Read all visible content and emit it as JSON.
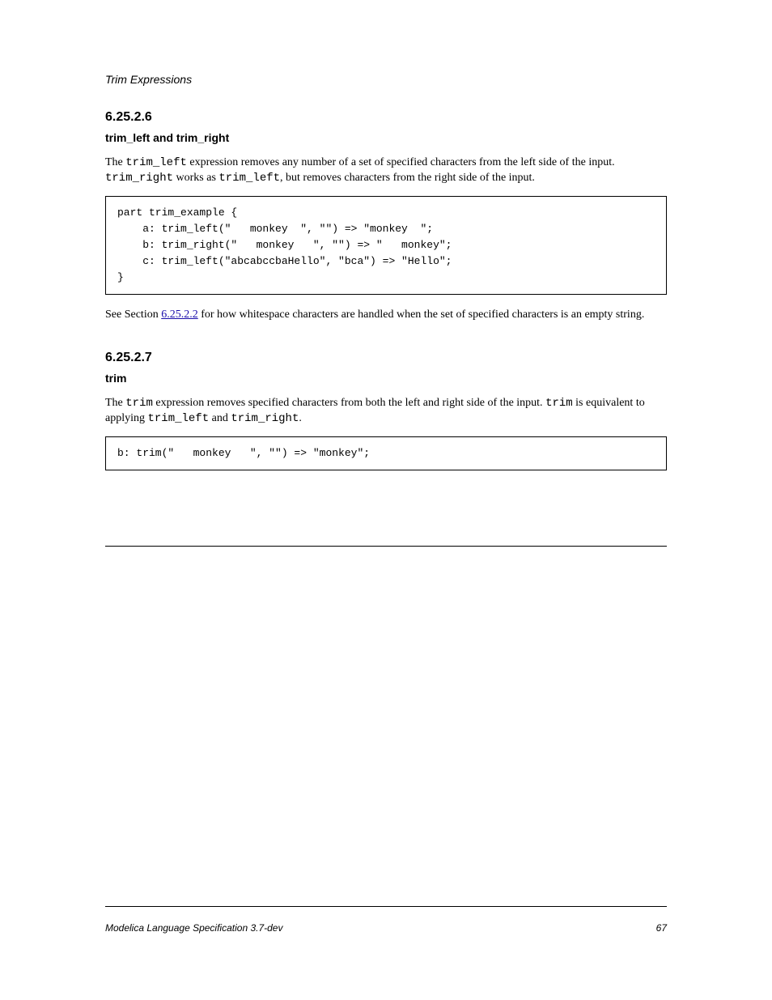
{
  "header": "Trim Expressions",
  "section1": {
    "num": "6.25.2.6",
    "title": "trim_left and trim_right"
  },
  "para1_a": "The ",
  "para1_code1": "trim_left",
  "para1_b": " expression removes any number of a set of specified characters from the left side of the input. ",
  "para1_code2": "trim_right",
  "para1_c": " works as ",
  "para1_code3": "trim_left",
  "para1_d": ", but removes characters from the right side of the input.",
  "codeblock1": "part trim_example {\n    a: trim_left(\"   monkey  \", \"\") => \"monkey  \";\n    b: trim_right(\"   monkey   \", \"\") => \"   monkey\";\n    c: trim_left(\"abcabccbaHello\", \"bca\") => \"Hello\";\n}",
  "para2_a": "See Section ",
  "xref": "6.25.2.2",
  "para2_b": " for how whitespace characters are handled when the set of specified characters is an empty string.",
  "section2": {
    "num": "6.25.2.7",
    "title": "trim"
  },
  "para3_a": "The ",
  "para3_code1": "trim",
  "para3_b": " expression removes specified characters from both the left and right side of the input. ",
  "para3_code2": "trim",
  "para3_c": " is equivalent to applying ",
  "para3_code3": "trim_left",
  "para3_d": " and ",
  "para3_code4": "trim_right",
  "para3_e": ".",
  "codeblock2": "b: trim(\"   monkey   \", \"\") => \"monkey\";",
  "footer_left": "Modelica Language Specification 3.7-dev",
  "footer_right": "67"
}
